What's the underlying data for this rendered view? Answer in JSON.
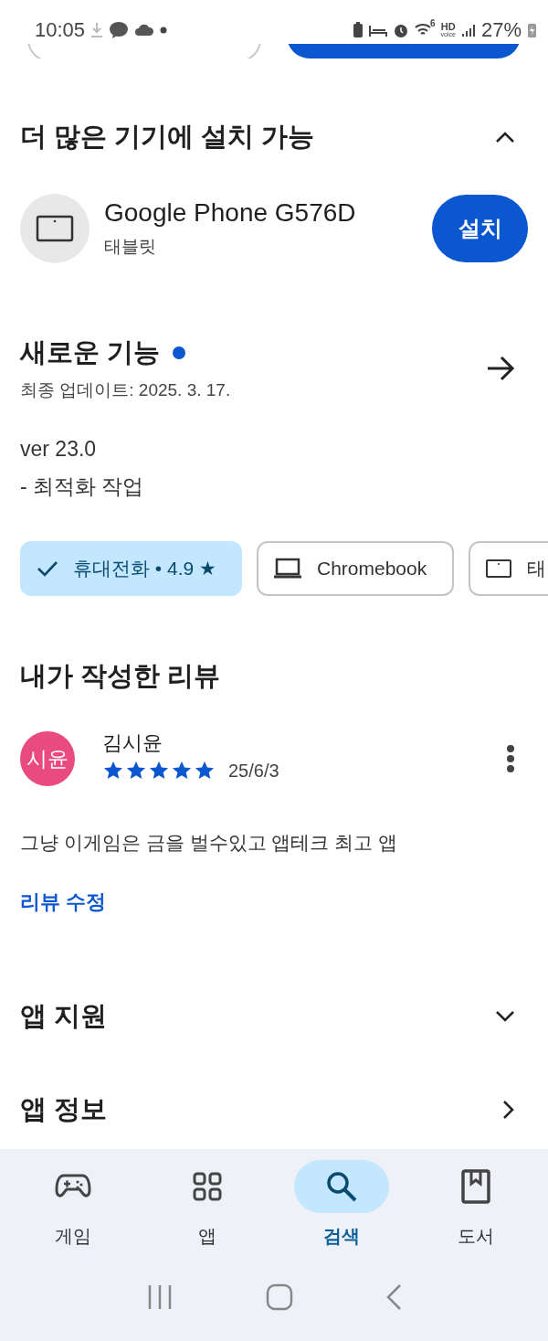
{
  "status_bar": {
    "time": "10:05",
    "wifi_band": "6",
    "hd": "HD",
    "voice": "voice",
    "battery": "27%"
  },
  "install_section": {
    "title": "더 많은 기기에 설치 가능",
    "expanded": true,
    "device": {
      "name": "Google Phone G576D",
      "type": "태블릿",
      "button": "설치"
    }
  },
  "whats_new": {
    "title": "새로운 기능",
    "new_dot": true,
    "updated": "최종 업데이트: 2025. 3. 17.",
    "lines": [
      "ver 23.0",
      "- 최적화 작업"
    ]
  },
  "device_chips": [
    {
      "label": "휴대전화 • 4.9 ★",
      "selected": true
    },
    {
      "kind": "laptop",
      "label": "Chromebook",
      "selected": false
    },
    {
      "kind": "tablet",
      "label": "태",
      "selected": false
    }
  ],
  "my_review": {
    "title": "내가 작성한 리뷰",
    "avatar": "시윤",
    "author": "김시윤",
    "stars": 5,
    "date": "25/6/3",
    "text": "그냥 이게임은 금을 벌수있고 앱테크 최고 앱",
    "edit": "리뷰 수정"
  },
  "app_support": {
    "title": "앱 지원",
    "expanded": false
  },
  "app_info": {
    "title": "앱 정보"
  },
  "bottom_nav": [
    {
      "kind": "games",
      "label": "게임",
      "selected": false
    },
    {
      "kind": "apps",
      "label": "앱",
      "selected": false
    },
    {
      "kind": "search",
      "label": "검색",
      "selected": true
    },
    {
      "kind": "books",
      "label": "도서",
      "selected": false
    }
  ]
}
